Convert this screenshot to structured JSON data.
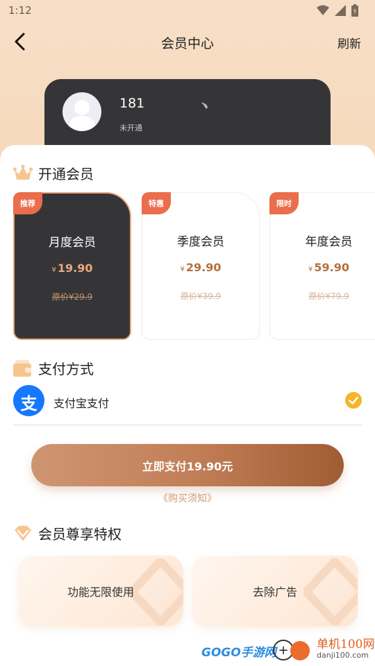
{
  "status_bar": {
    "time": "1:12"
  },
  "header": {
    "title": "会员中心",
    "refresh_label": "刷新"
  },
  "user": {
    "name": "181",
    "status": "未开通",
    "mark": "﹅"
  },
  "sections": {
    "membership": "开通会员",
    "payment": "支付方式",
    "privileges": "会员尊享特权"
  },
  "plans": [
    {
      "badge": "推荐",
      "name": "月度会员",
      "currency": "¥",
      "price": "19.90",
      "original": "原价¥29.9",
      "selected": true
    },
    {
      "badge": "特惠",
      "name": "季度会员",
      "currency": "¥",
      "price": "29.90",
      "original": "原价¥39.9",
      "selected": false
    },
    {
      "badge": "限时",
      "name": "年度会员",
      "currency": "¥",
      "price": "59.90",
      "original": "原价¥79.9",
      "selected": false
    }
  ],
  "payment": {
    "method": "支付宝支付",
    "alipay_glyph": "支",
    "selected": true
  },
  "pay_button_label": "立即支付19.90元",
  "notice_link": "《购买须知》",
  "privileges": [
    "功能无限使用",
    "去除广告"
  ],
  "watermark": {
    "brand": "GOGO手游网",
    "site": "单机100网",
    "url": "danji100.com"
  },
  "colors": {
    "accent": "#e8a47c",
    "badge": "#ea6d4c",
    "card_dark": "#353538",
    "alipay": "#1678ff",
    "check": "#f6b42a"
  }
}
